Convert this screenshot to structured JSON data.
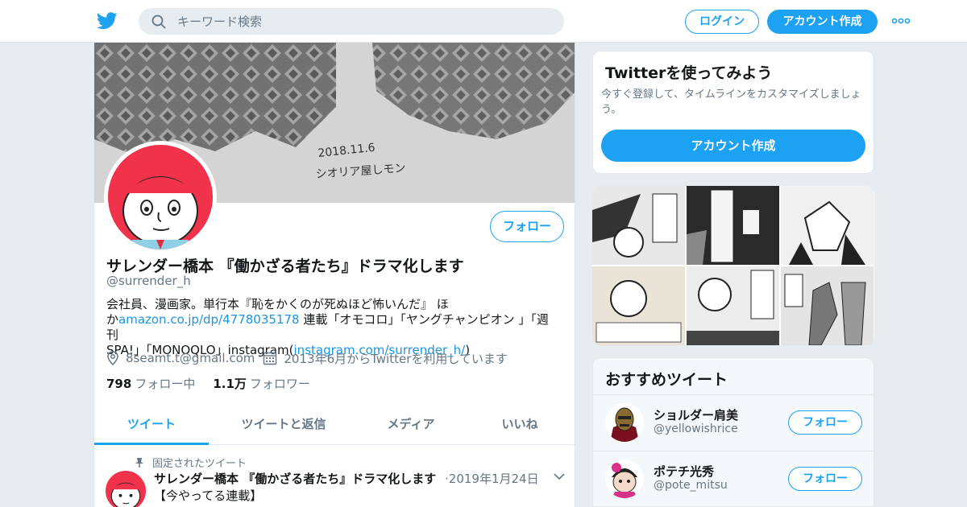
{
  "header": {
    "search_placeholder": "キーワード検索",
    "login_label": "ログイン",
    "signup_label": "アカウント作成",
    "logo_icon": "twitter-bird-icon",
    "accent": "#1da1f2"
  },
  "profile": {
    "banner_text_date": "2018.11.6",
    "banner_text_author": "シオリア屋しモン",
    "follow_label": "フォロー",
    "display_name": "サレンダー橋本 『働かざる者たち』ドラマ化します",
    "handle": "@surrender_h",
    "bio": {
      "line1": "会社員、漫画家。単行本『恥をかくのが死ぬほど怖いんだ』 ほ",
      "line2_prefix": "か",
      "link1": "amazon.co.jp/dp/4778035178",
      "line2_suffix": " 連載「オモコロ」「ヤングチャンピオン 」「週刊",
      "line3_prefix": "SPA!」「MONOQLO」instagram(",
      "link2": "instagram.com/surrender_h/",
      "line3_suffix": ")"
    },
    "email": "8seamt.t@gmail.com",
    "joined": "2013年6月からTwitterを利用しています",
    "following_count": "798",
    "following_label": "フォロー中",
    "followers_count": "1.1万",
    "followers_label": "フォロワー"
  },
  "tabs": [
    {
      "label": "ツイート",
      "active": true
    },
    {
      "label": "ツイートと返信",
      "active": false
    },
    {
      "label": "メディア",
      "active": false
    },
    {
      "label": "いいね",
      "active": false
    }
  ],
  "pinned_tweet": {
    "pinned_label": "固定されたツイート",
    "author": "サレンダー橋本 『働かざる者たち』ドラマ化します",
    "dot": "‏ · ",
    "date": "2019年1月24日",
    "body": "【今やってる連載】"
  },
  "sidebar": {
    "signup_title": "Twitterを使ってみよう",
    "signup_text": "今すぐ登録して、タイムラインをカスタマイズしましょう。",
    "signup_button": "アカウント作成",
    "recs_title": "おすすめツイート",
    "recs": [
      {
        "name": "ショルダー肩美",
        "handle": "@yellowishrice",
        "follow": "フォロー"
      },
      {
        "name": "ポテチ光秀",
        "handle": "@pote_mitsu",
        "follow": "フォロー"
      }
    ]
  }
}
